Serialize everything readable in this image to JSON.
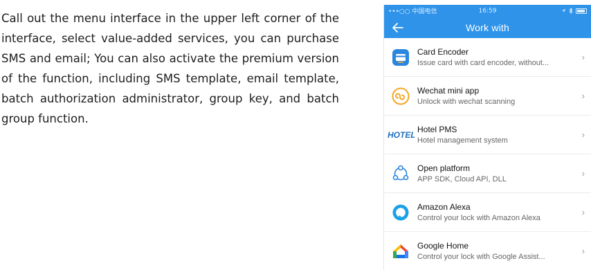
{
  "instructions": {
    "text": "Call out the menu interface in the upper left corner of the interface, select value-added services, you can purchase SMS and email; You can also activate the premium version of the function, including SMS template, email template, batch authorization administrator, group key, and batch group function."
  },
  "status_bar": {
    "carrier": "•••○○ 中国电信",
    "time": "16:59",
    "icons": [
      "wifi-icon",
      "location-icon",
      "bluetooth-icon",
      "battery-icon"
    ]
  },
  "nav": {
    "title": "Work with",
    "back_icon": "back-arrow-icon"
  },
  "colors": {
    "accent": "#2f93e9",
    "card_blue": "#2b86e0",
    "wechat_orange": "#f4a623",
    "alexa_blue": "#1ca0e6"
  },
  "items": [
    {
      "title": "Card Encoder",
      "subtitle": "Issue card with card encoder, without...",
      "icon": "card-encoder-icon"
    },
    {
      "title": "Wechat mini app",
      "subtitle": "Unlock with wechat scanning",
      "icon": "wechat-mini-app-icon"
    },
    {
      "title": "Hotel PMS",
      "subtitle": "Hotel management system",
      "icon": "hotel-logo-icon",
      "logo_text": "HOTEL"
    },
    {
      "title": "Open platform",
      "subtitle": "APP SDK, Cloud API, DLL",
      "icon": "open-platform-icon"
    },
    {
      "title": "Amazon Alexa",
      "subtitle": "Control your lock with Amazon Alexa",
      "icon": "alexa-icon"
    },
    {
      "title": "Google Home",
      "subtitle": "Control your lock with Google Assist...",
      "icon": "google-home-icon"
    }
  ]
}
